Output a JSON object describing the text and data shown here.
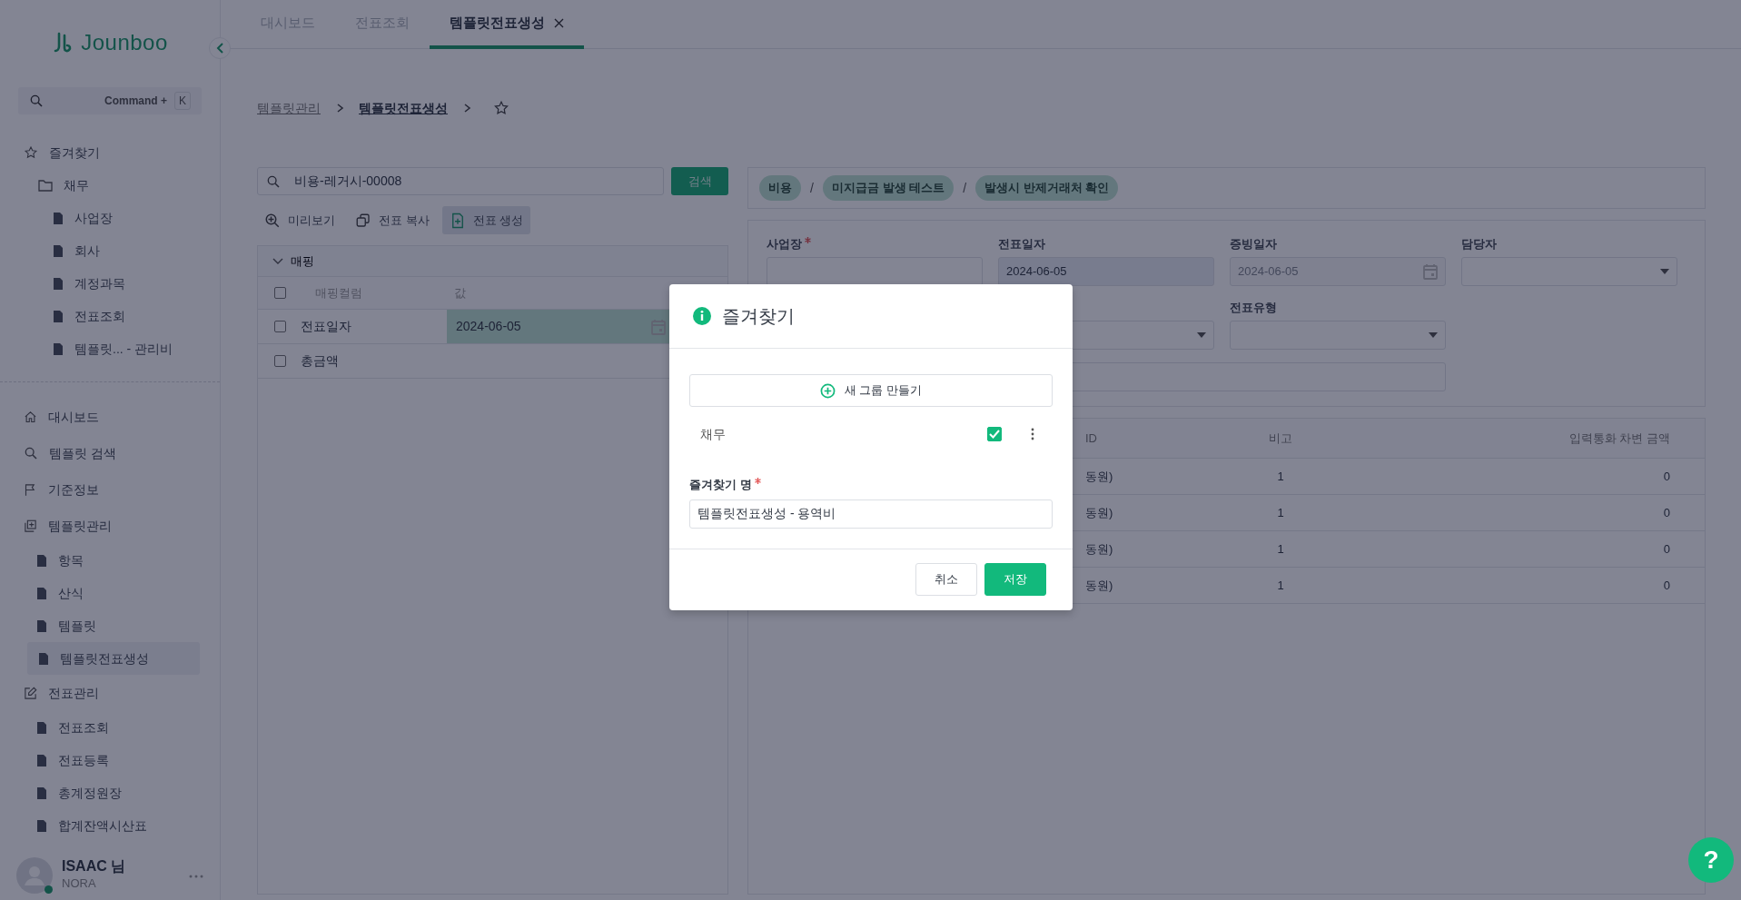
{
  "sidebar": {
    "logo": "Jounboo",
    "search": {
      "shortcut_prefix": "Command +",
      "shortcut_key": "K"
    },
    "favorites": {
      "label": "즐겨찾기",
      "groups": [
        {
          "label": "채무",
          "children": [
            {
              "label": "사업장",
              "selected": false
            },
            {
              "label": "회사",
              "selected": false
            },
            {
              "label": "계정과목",
              "selected": false
            },
            {
              "label": "전표조회",
              "selected": false
            },
            {
              "label": "템플릿...   - 관리비",
              "selected": false
            }
          ]
        }
      ]
    },
    "menu": [
      {
        "label": "대시보드",
        "kind": "home"
      },
      {
        "label": "템플릿 검색",
        "kind": "search"
      },
      {
        "label": "기준정보",
        "kind": "flag"
      },
      {
        "label": "템플릿관리",
        "kind": "template",
        "children": [
          {
            "label": "항목",
            "selected": false
          },
          {
            "label": "산식",
            "selected": false
          },
          {
            "label": "템플릿",
            "selected": false
          },
          {
            "label": "템플릿전표생성",
            "selected": true
          }
        ]
      },
      {
        "label": "전표관리",
        "kind": "edit",
        "children": [
          {
            "label": "전표조회",
            "selected": false
          },
          {
            "label": "전표등록",
            "selected": false
          },
          {
            "label": "총계정원장",
            "selected": false
          },
          {
            "label": "합계잔액시산표",
            "selected": false
          }
        ]
      }
    ],
    "user": {
      "name": "ISAAC 님",
      "org": "NORA",
      "online": true
    }
  },
  "tabs": [
    {
      "label": "대시보드",
      "selected": false,
      "closable": false
    },
    {
      "label": "전표조회",
      "selected": false,
      "closable": false
    },
    {
      "label": "템플릿전표생성",
      "selected": true,
      "closable": true
    }
  ],
  "breadcrumb": [
    "템플릿관리",
    "템플릿전표생성"
  ],
  "left_panel": {
    "search": {
      "value": "비용-레거시-00008",
      "button": "검색"
    },
    "toolbar": [
      {
        "label": "미리보기",
        "kind": "preview",
        "selected": false
      },
      {
        "label": "전표 복사",
        "kind": "copy",
        "selected": false
      },
      {
        "label": "전표 생성",
        "kind": "create",
        "selected": true
      }
    ],
    "mapping": {
      "title": "매핑",
      "expanded": true,
      "all_checked": false,
      "columns": [
        "매핑컬럼",
        "값"
      ],
      "rows": [
        {
          "name": "전표일자",
          "value": "2024-06-05",
          "checked": false,
          "highlighted": true
        },
        {
          "name": "총금액",
          "checked": false,
          "highlighted": false
        }
      ]
    }
  },
  "right_panel": {
    "chips": [
      "비용",
      "미지급금 발생 테스트",
      "발생시 반제거래처 확인"
    ],
    "chip_separator": "/",
    "form": {
      "rows": [
        [
          {
            "label": "사업장",
            "required": true,
            "kind": "text"
          },
          {
            "label": "전표일자",
            "required": false,
            "kind": "text",
            "value": "2024-06-05"
          },
          {
            "label": "증빙일자",
            "required": false,
            "kind": "date",
            "value": "2024-06-05",
            "disabled": true
          },
          {
            "label": "담당자",
            "required": false,
            "kind": "select"
          }
        ],
        [
          "",
          {
            "kind": "select"
          },
          {
            "label": "전표유형",
            "required": false,
            "kind": "select"
          }
        ],
        [
          "",
          {
            "kind": "memo"
          }
        ]
      ]
    },
    "table": {
      "columns": [
        "ID",
        "비고",
        "입력통화 차변 금액"
      ],
      "rows": [
        [
          "동원)",
          "1",
          "0"
        ],
        [
          "동원)",
          "1",
          "0"
        ],
        [
          "동원)",
          "1",
          "0"
        ],
        [
          "동원)",
          "1",
          "0"
        ]
      ]
    }
  },
  "modal": {
    "title": "즐겨찾기",
    "new_group": "새 그룹 만들기",
    "groups": [
      {
        "label": "채무",
        "checked": true
      }
    ],
    "name_label": "즐겨찾기 명",
    "name_required": true,
    "name_value": "템플릿전표생성 - 용역비",
    "buttons": [
      {
        "label": "취소",
        "kind": "secondary"
      },
      {
        "label": "저장",
        "kind": "primary"
      }
    ]
  },
  "help": "?"
}
